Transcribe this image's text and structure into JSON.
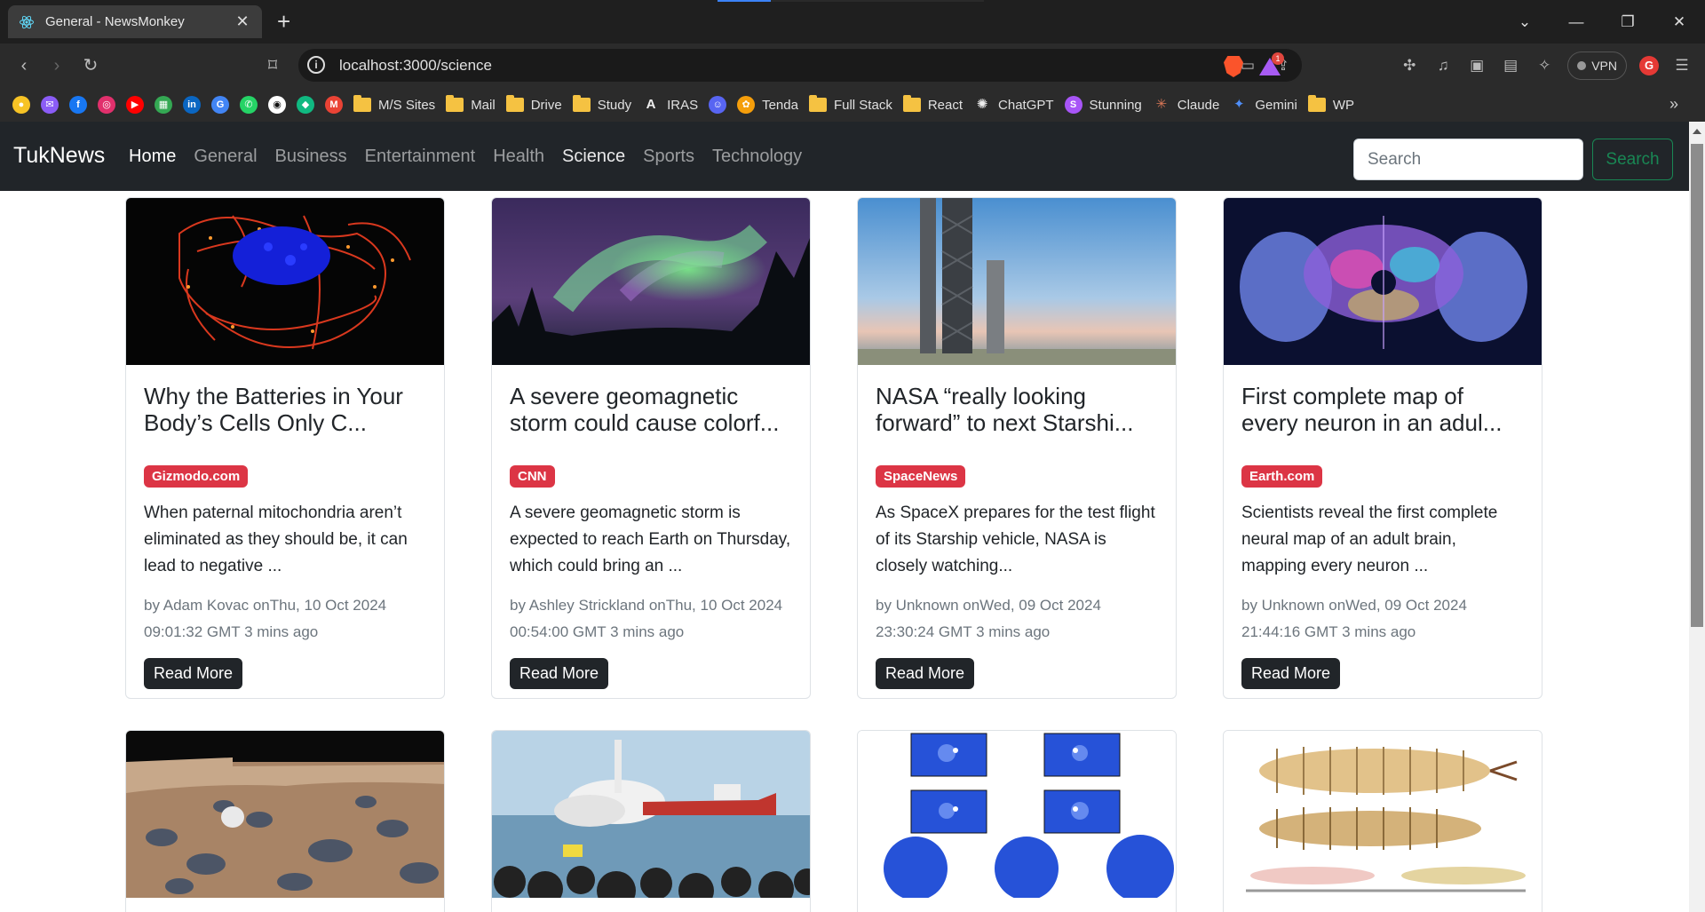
{
  "browser": {
    "tab_title": "General - NewsMonkey",
    "url_host": "localhost",
    "url_rest": ":3000/science",
    "vpn_label": "VPN",
    "rewards_count": "1",
    "profile_initial": "G",
    "bookmarks": [
      {
        "label": "",
        "icon": "keep-icon",
        "color": "#f7c325"
      },
      {
        "label": "",
        "icon": "messenger-icon",
        "color": "#8b5cf6"
      },
      {
        "label": "",
        "icon": "facebook-icon",
        "color": "#1877f2"
      },
      {
        "label": "",
        "icon": "instagram-icon",
        "color": "#e1306c"
      },
      {
        "label": "",
        "icon": "youtube-icon",
        "color": "#ff0000"
      },
      {
        "label": "",
        "icon": "photos-icon",
        "color": "#34a853"
      },
      {
        "label": "",
        "icon": "linkedin-icon",
        "color": "#0a66c2"
      },
      {
        "label": "",
        "icon": "translate-icon",
        "color": "#4285f4"
      },
      {
        "label": "",
        "icon": "whatsapp-icon",
        "color": "#25d366"
      },
      {
        "label": "",
        "icon": "github-icon",
        "color": "#ffffff"
      },
      {
        "label": "",
        "icon": "diamond-icon",
        "color": "#10b981"
      },
      {
        "label": "",
        "icon": "gmail-icon",
        "color": "#ea4335"
      },
      {
        "label": "M/S Sites",
        "icon": "folder-icon"
      },
      {
        "label": "Mail",
        "icon": "folder-icon"
      },
      {
        "label": "Drive",
        "icon": "folder-icon"
      },
      {
        "label": "Study",
        "icon": "folder-icon"
      },
      {
        "label": "IRAS",
        "icon": "iras-icon",
        "color": "#2b2b2b"
      },
      {
        "label": "",
        "icon": "discord-icon",
        "color": "#5865f2"
      },
      {
        "label": "Tenda",
        "icon": "tenda-icon",
        "color": "#f59e0b"
      },
      {
        "label": "Full Stack",
        "icon": "folder-icon"
      },
      {
        "label": "React",
        "icon": "folder-icon"
      },
      {
        "label": "ChatGPT",
        "icon": "chatgpt-icon",
        "color": "#2b2b2b"
      },
      {
        "label": "Stunning",
        "icon": "stunning-icon",
        "color": "#a855f7"
      },
      {
        "label": "Claude",
        "icon": "claude-icon",
        "color": "#d97757"
      },
      {
        "label": "Gemini",
        "icon": "gemini-icon",
        "color": "#4f8ef7"
      },
      {
        "label": "WP",
        "icon": "folder-icon"
      }
    ]
  },
  "navbar": {
    "brand": "TukNews",
    "links": [
      "Home",
      "General",
      "Business",
      "Entertainment",
      "Health",
      "Science",
      "Sports",
      "Technology"
    ],
    "search_placeholder": "Search",
    "search_button": "Search"
  },
  "articles": [
    {
      "title": "Why the Batteries in Your Body’s Cells Only C...",
      "source": "Gizmodo.com",
      "description": "When paternal mitochondria aren’t eliminated as they should be, it can lead to negative ...",
      "meta": "by Adam Kovac onThu, 10 Oct 2024 09:01:32 GMT 3 mins ago",
      "button": "Read More"
    },
    {
      "title": "A severe geomagnetic storm could cause colorf...",
      "source": "CNN",
      "description": "A severe geomagnetic storm is expected to reach Earth on Thursday, which could bring an ...",
      "meta": "by Ashley Strickland onThu, 10 Oct 2024 00:54:00 GMT 3 mins ago",
      "button": "Read More"
    },
    {
      "title": "NASA “really looking forward” to next Starshi...",
      "source": "SpaceNews",
      "description": "As SpaceX prepares for the test flight of its Starship vehicle, NASA is closely watching...",
      "meta": "by Unknown onWed, 09 Oct 2024 23:30:24 GMT 3 mins ago",
      "button": "Read More"
    },
    {
      "title": "First complete map of every neuron in an adul...",
      "source": "Earth.com",
      "description": "Scientists reveal the first complete neural map of an adult brain, mapping every neuron ...",
      "meta": "by Unknown onWed, 09 Oct 2024 21:44:16 GMT 3 mins ago",
      "button": "Read More"
    }
  ],
  "colors": {
    "navbar_bg": "#212529",
    "badge_bg": "#dc3545",
    "search_btn": "#198754",
    "chrome_bg": "#2b2b2b"
  }
}
